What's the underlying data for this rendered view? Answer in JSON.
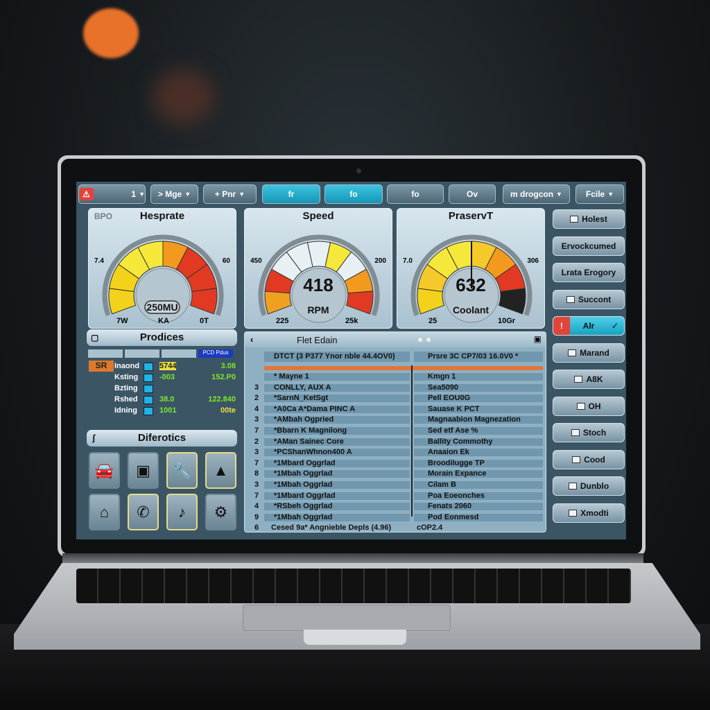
{
  "toolbar": {
    "items": [
      {
        "label": "1",
        "icon": "warning-icon",
        "dropdown": true
      },
      {
        "label": "> Mge",
        "dropdown": true
      },
      {
        "label": "+ Pnr",
        "dropdown": true
      },
      {
        "label": "fr",
        "active": true
      },
      {
        "label": "fo",
        "active": true
      },
      {
        "label": "fo"
      },
      {
        "label": "Ov"
      },
      {
        "label": "m drogcon",
        "dropdown": true
      },
      {
        "label": "Fcile",
        "dropdown": true
      }
    ]
  },
  "gauges": [
    {
      "tag": "BPO",
      "title": "Hesprate",
      "value": "",
      "unit": "250MU",
      "scale_left": "7.4",
      "scale_right": "60",
      "bottom": [
        "7W",
        "KA",
        "0T"
      ],
      "colors": [
        "#f2d21a",
        "#f2d21a",
        "#f5e83a",
        "#f5e83a",
        "#f39a1e",
        "#e23a22",
        "#e23a22",
        "#e23a22"
      ]
    },
    {
      "tag": "",
      "title": "Speed",
      "value": "418",
      "unit": "RPM",
      "scale_left": "450",
      "scale_right": "200",
      "bottom": [
        "225",
        "25k"
      ],
      "colors": [
        "#f0a020",
        "#e23a22",
        "#e8f0f4",
        "#e8f0f4",
        "#e8f0f4",
        "#f5e83a",
        "#e8f0f4",
        "#f39a1e",
        "#e23a22"
      ]
    },
    {
      "tag": "",
      "title": "PraservT",
      "value": "632",
      "unit": "Coolant",
      "scale_left": "7.0",
      "scale_right": "306",
      "bottom": [
        "25",
        "10Gr"
      ],
      "colors": [
        "#f2d21a",
        "#f5c92a",
        "#f5e83a",
        "#f5e83a",
        "#f5c92a",
        "#f39a1e",
        "#e23a22",
        "#222"
      ]
    }
  ],
  "right_buttons": [
    {
      "label": "Holest",
      "icon": "hand-icon"
    },
    {
      "label": "Ervockcumed",
      "icon": ""
    },
    {
      "label": "Lrata Erogory",
      "icon": ""
    },
    {
      "label": "Succont",
      "icon": "flag-icon"
    },
    {
      "label": "Alr",
      "icon": "alert-icon",
      "selected": true
    },
    {
      "label": "Marand",
      "icon": "car-icon"
    },
    {
      "label": "A8K",
      "icon": "pen-icon"
    },
    {
      "label": "OH",
      "icon": "engine-icon"
    },
    {
      "label": "Stoch",
      "icon": "mountain-icon"
    },
    {
      "label": "Cood",
      "icon": "battery-icon"
    },
    {
      "label": "Dunblo",
      "icon": "line-icon"
    },
    {
      "label": "Xmodti",
      "icon": "door-icon"
    }
  ],
  "prodices": {
    "title": "Prodices",
    "badge": "SR",
    "columns": [
      "",
      "",
      "",
      "PCD Pdus"
    ],
    "rows": [
      {
        "label": "Inaond",
        "v1": "5744",
        "v2": "3.08"
      },
      {
        "label": "Ksting",
        "v1": "-003",
        "v2": "152.P0"
      },
      {
        "label": "Bzting",
        "v1": "",
        "v2": ""
      },
      {
        "label": "Rshed",
        "v1": "38.0",
        "v2": "122.840"
      },
      {
        "label": "Idning",
        "v1": "1001",
        "v2": "00te"
      }
    ]
  },
  "diferotics": {
    "title": "Diferotics",
    "icons": [
      "car-front-icon",
      "basket-icon",
      "wrench-icon",
      "turtle-icon",
      "home-icon",
      "phone-icon",
      "note-icon",
      "gear-icon"
    ]
  },
  "dtc": {
    "title": "Flet Edain",
    "col_a": "DTCT (3 P377 Ynor nble 44.4OV0)",
    "col_b": "Prsre 3C CP7/03 16.0V0 *",
    "rows": [
      {
        "n": "",
        "a": "* Mayne 1",
        "b": "Kmgn 1"
      },
      {
        "n": "3",
        "a": "CONLLY, AUX A",
        "b": "Sea5090"
      },
      {
        "n": "2",
        "a": "*SarnN_KetSgt",
        "b": "Pell EOU0G"
      },
      {
        "n": "4",
        "a": "*A0Ca A*Dama PINC A",
        "b": "Sauase K PCT"
      },
      {
        "n": "3",
        "a": "*AMbah Ogpried",
        "b": "Magnaabion Magnezation"
      },
      {
        "n": "7",
        "a": "*Bbarn K Magnilong",
        "b": "Sed etf Ase %"
      },
      {
        "n": "2",
        "a": "*AMan Sainec Core",
        "b": "Ballity Commothy"
      },
      {
        "n": "3",
        "a": "*PCShanWhnon400 A",
        "b": "Anaaion Ek"
      },
      {
        "n": "7",
        "a": "*1Mbard Oggrlad",
        "b": "Broodilugge TP"
      },
      {
        "n": "8",
        "a": "*1Mbah Oggrlad",
        "b": "Morain Expance"
      },
      {
        "n": "3",
        "a": "*1Mbah Oggrlad",
        "b": "Cilam B"
      },
      {
        "n": "7",
        "a": "*1Mbard Oggrlad",
        "b": "Poa Eoeonches"
      },
      {
        "n": "4",
        "a": "*RSbeh Oggrlad",
        "b": "Fenats 2060"
      },
      {
        "n": "9",
        "a": "*1Mbah Oggrlad",
        "b": "Pod Eonmesd"
      }
    ],
    "footer_a": "Cesed 9a* Angnieble Depls (4.96)",
    "footer_b": "cOP2.4"
  }
}
